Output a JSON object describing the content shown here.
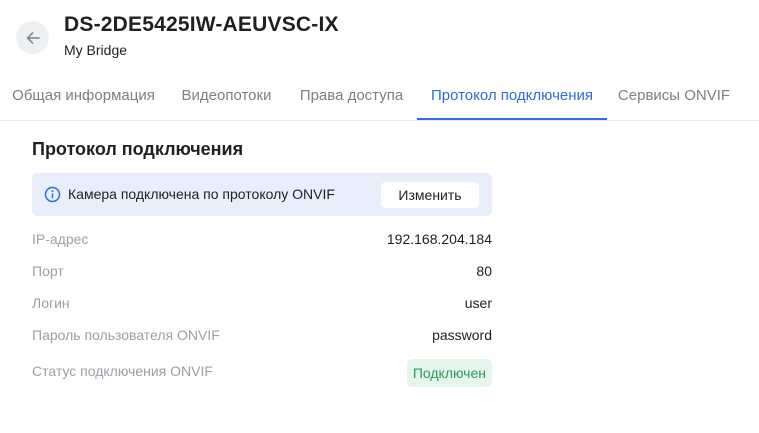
{
  "header": {
    "title": "DS-2DE5425IW-AEUVSC-IX",
    "subtitle": "My Bridge"
  },
  "tabs": [
    {
      "label": "Общая информация",
      "active": false
    },
    {
      "label": "Видеопотоки",
      "active": false
    },
    {
      "label": "Права доступа",
      "active": false
    },
    {
      "label": "Протокол подключения",
      "active": true
    },
    {
      "label": "Сервисы ONVIF",
      "active": false
    }
  ],
  "section": {
    "title": "Протокол подключения",
    "info": {
      "text": "Камера подключена по протоколу ONVIF",
      "button_label": "Изменить"
    },
    "fields": [
      {
        "label": "IP-адрес",
        "value": "192.168.204.184"
      },
      {
        "label": "Порт",
        "value": "80"
      },
      {
        "label": "Логин",
        "value": "user"
      },
      {
        "label": "Пароль пользователя ONVIF",
        "value": "password"
      },
      {
        "label": "Статус подключения ONVIF",
        "value": "Подключен"
      }
    ]
  },
  "colors": {
    "accent": "#2c6fd8",
    "info_background": "#e8eefc",
    "status_ok_text": "#2a9a5a",
    "status_ok_background": "#e4f5ec"
  },
  "icons": {
    "back": "arrow-left-icon",
    "info": "info-circle-icon"
  }
}
